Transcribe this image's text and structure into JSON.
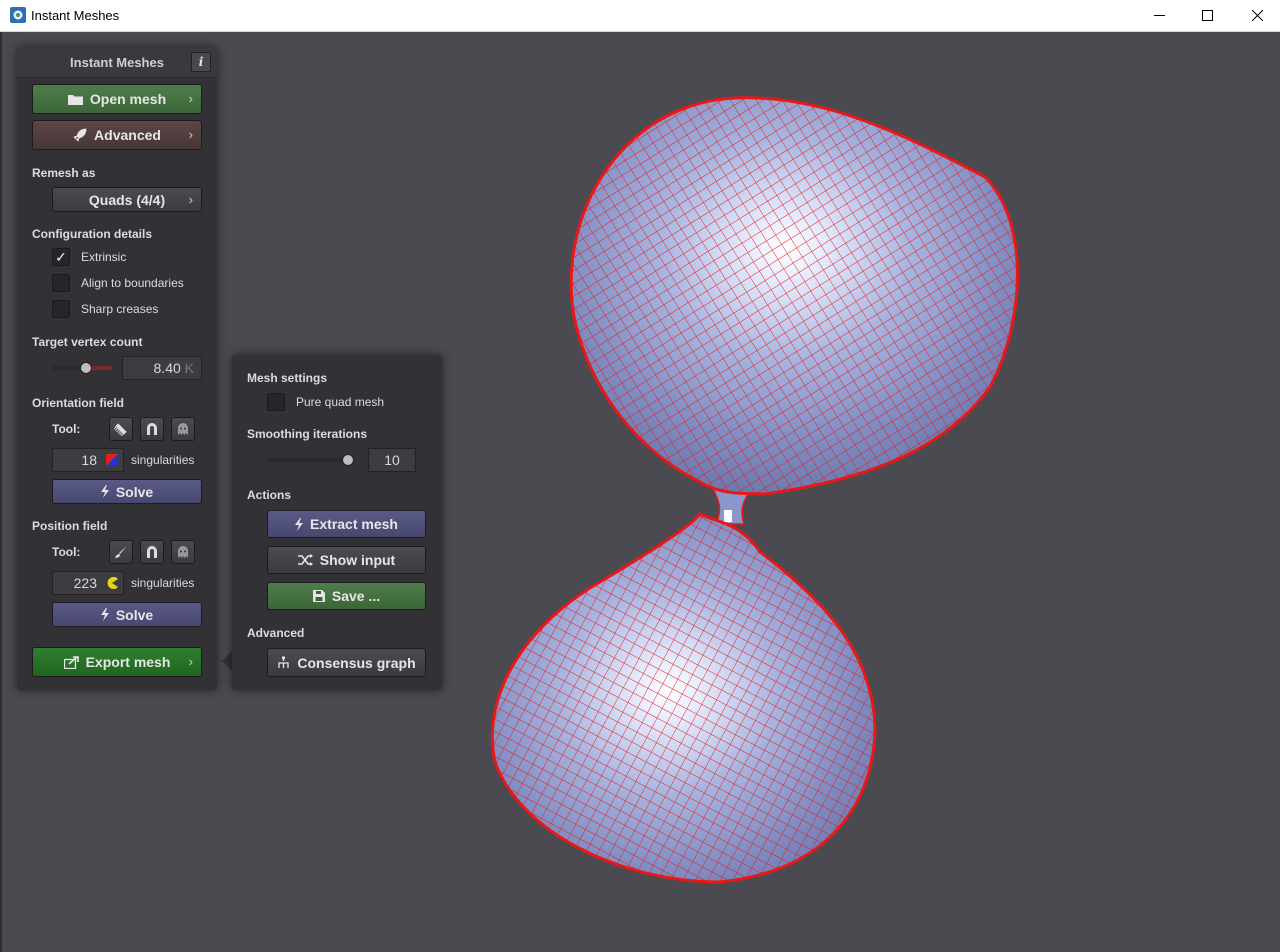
{
  "window": {
    "title": "Instant Meshes"
  },
  "main_panel": {
    "title": "Instant Meshes",
    "info_label": "i",
    "open_mesh_label": "Open mesh",
    "advanced_label": "Advanced",
    "remesh_as_label": "Remesh as",
    "remesh_mode": "Quads (4/4)",
    "config_label": "Configuration details",
    "checks": [
      {
        "label": "Extrinsic",
        "checked": true
      },
      {
        "label": "Align to boundaries",
        "checked": false
      },
      {
        "label": "Sharp creases",
        "checked": false
      }
    ],
    "target_vertex_label": "Target vertex count",
    "target_vertex_value": "8.40",
    "target_vertex_unit": "K",
    "orientation_label": "Orientation field",
    "tool_label": "Tool:",
    "orientation_singularities": "18",
    "singularities_label": "singularities",
    "solve_label": "Solve",
    "position_label": "Position field",
    "position_singularities": "223",
    "export_label": "Export mesh"
  },
  "export_panel": {
    "mesh_settings_label": "Mesh settings",
    "pure_quad_label": "Pure quad mesh",
    "smoothing_label": "Smoothing iterations",
    "smoothing_value": "10",
    "actions_label": "Actions",
    "extract_label": "Extract mesh",
    "show_input_label": "Show input",
    "save_label": "Save ...",
    "advanced_label": "Advanced",
    "consensus_label": "Consensus graph"
  }
}
